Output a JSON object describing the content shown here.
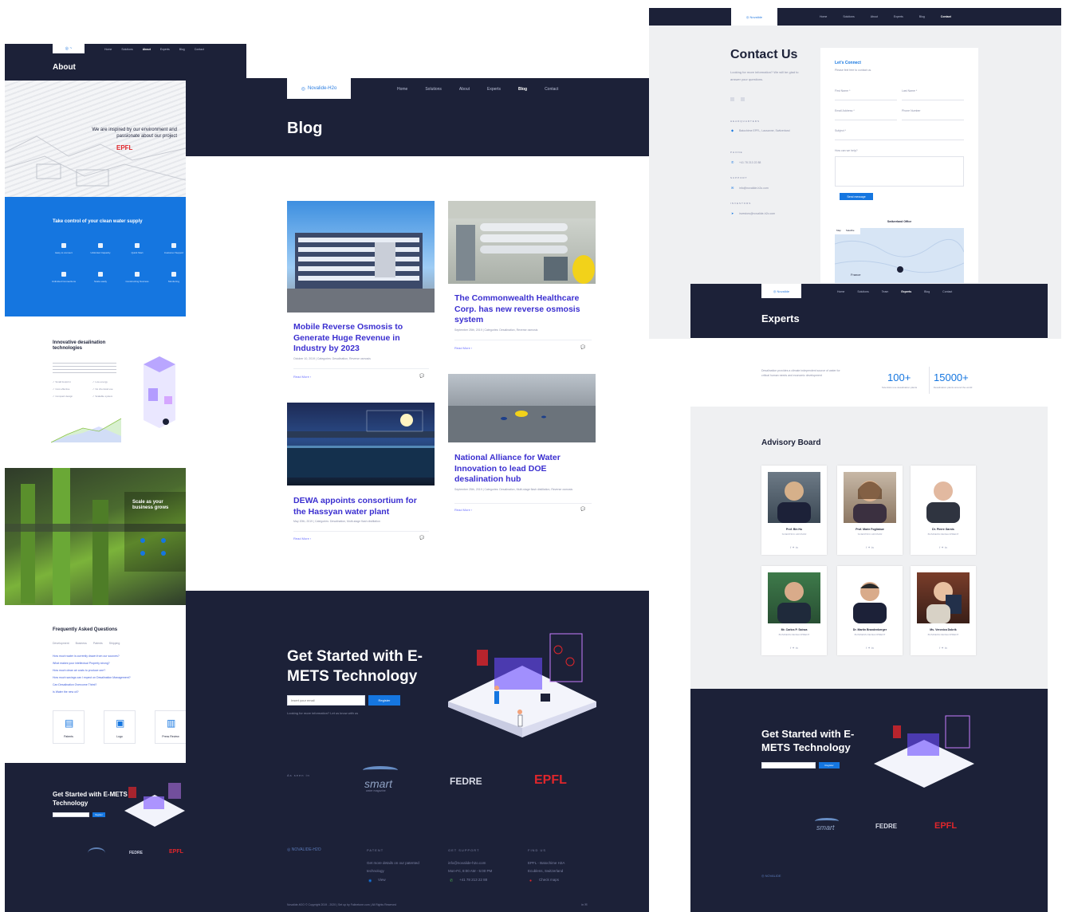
{
  "about_panel": {
    "nav_items": [
      "Home",
      "Solutions",
      "About",
      "Experts",
      "Blog",
      "Contact"
    ],
    "active_nav": "About",
    "title": "About",
    "hero_text": "We are inspired by our environment and passionate about our project",
    "hero_logo": "EPFL",
    "blue_title": "Take control of your clean water supply",
    "features": [
      "Easy to connect",
      "Unlimited Capacity",
      "Quick Start",
      "Customer Support",
      "Unlimited Connections",
      "Scale easily",
      "Constructing Success",
      "Monitoring"
    ],
    "innovative_title": "Innovative desalination technologies",
    "checks": [
      "Small footprint",
      "Low energy",
      "Cost effective",
      "No chemical use",
      "Compact design",
      "Scalable system"
    ],
    "scale_title": "Scale as your business grows",
    "faq_title": "Frequently Asked Questions",
    "faq_tabs": [
      "Development",
      "Business",
      "Patents",
      "Shipping"
    ],
    "faq_items": [
      "How much water is currently drawn from our sources?",
      "What makes your intellectual Property strong?",
      "How much clean air costs to produce one?",
      "How much savings can I expect on Desalination Management?",
      "Can Desalination Overcome Thirst?",
      "Is Water the new oil?"
    ],
    "docs": [
      "Patents",
      "Logo",
      "Press Review"
    ],
    "cta_title": "Get Started with E-METS Technology",
    "cta_button": "Register"
  },
  "blog_panel": {
    "nav_items": [
      "Home",
      "Solutions",
      "About",
      "Experts",
      "Blog",
      "Contact"
    ],
    "active_nav": "Blog",
    "logo_text": "Novalide-H2o",
    "title": "Blog",
    "posts": [
      {
        "title": "Mobile Reverse Osmosis to Generate Huge Revenue in Industry by 2023",
        "meta": "October 10, 2019 | Categories: Desalination, Reverse osmosis",
        "more": "Read More ›",
        "comments": "0"
      },
      {
        "title": "The Commonwealth Healthcare Corp. has new reverse osmosis system",
        "meta": "September 25th, 2019 | Categories: Desalination, Reverse osmosis",
        "more": "Read More ›",
        "comments": "0"
      },
      {
        "title": "DEWA appoints consortium for the Hassyan water plant",
        "meta": "May 20th, 2019 | Categories: Desalination, Multi-stage flash distillation",
        "more": "Read More ›",
        "comments": "0"
      },
      {
        "title": "National Alliance for Water Innovation to lead DOE desalination hub",
        "meta": "September 25th, 2019 | Categories: Desalination, Multi-stage flash distillation, Reverse osmosis",
        "more": "Read More ›",
        "comments": "0"
      }
    ],
    "cta_title": "Get Started with E-METS Technology",
    "cta_placeholder": "Insert your email",
    "cta_button": "Register",
    "cta_note": "Looking for more information? Let us know with us",
    "partners_label": "As seen in",
    "partners": [
      "smart",
      "FEDRE",
      "EPFL"
    ],
    "smart_sub": "water magazine",
    "footer": {
      "col1_head": "PATENT",
      "col1_text": "Get more details on our patented technology",
      "col1_link": "View",
      "col2_head": "GET SUPPORT",
      "col2_email": "info@novalide-h2o.com",
      "col2_hours": "Mon-Fri, 8:00 AM - 5:00 PM",
      "col2_phone": "+41 78 213 22 88",
      "col3_head": "FIND US",
      "col3_addr1": "EPFL - Batochime H2A",
      "col3_addr2": "Ecublens, Switzerland",
      "col3_link": "Check maps",
      "copyright": "Novalide-H2O © Copyright 2019 - 2020 | Set up by Falinetone.com | All Rights Reserved"
    }
  },
  "contact_panel": {
    "nav_items": [
      "Home",
      "Solutions",
      "About",
      "Experts",
      "Blog",
      "Contact"
    ],
    "active_nav": "Contact",
    "title": "Contact Us",
    "intro": "Looking for more information? We will be glad to answer your questions.",
    "headquarters_label": "HEADQUARTERS",
    "headquarters": "Batochime EPFL, Lausanne, Switzerland",
    "phone_label": "PHONE",
    "phone": "+41 78 213 22 88",
    "support_label": "SUPPORT",
    "support": "info@novalide-h2o.com",
    "investors_label": "INVESTORS",
    "investors": "investors@novalide-h2o.com",
    "form_title": "Let's Connect",
    "form_sub": "Please feel free to contact us.",
    "fields": [
      "First Name *",
      "Last Name *",
      "Email Address *",
      "Phone Number",
      "Subject *",
      "How can we help?"
    ],
    "send_button": "Send message",
    "map_title": "Switzerland Office",
    "map_tabs": [
      "Map",
      "Satellite"
    ],
    "map_label": "France"
  },
  "experts_panel": {
    "nav_items": [
      "Home",
      "Solutions",
      "Team",
      "Experts",
      "Blog",
      "Contact"
    ],
    "active_nav": "Experts",
    "title": "Experts",
    "intro": "Desalination provides a climate independent source of water for critical human needs and economic development",
    "stat1_value": "100+",
    "stat1_label": "Scientists use desalination plants",
    "stat2_value": "15000+",
    "stat2_label": "Desalination plants around the world",
    "board_title": "Advisory Board",
    "experts": [
      {
        "name": "Prof. Bin Hu",
        "role": "SCIENTIFIC ADVISOR"
      },
      {
        "name": "Prof. Marie Fogliabue",
        "role": "SCIENTIFIC ADVISOR"
      },
      {
        "name": "Dr. Pierre Garnis",
        "role": "BUSINESS DEVELOPMENT"
      },
      {
        "name": "Mr. Carlos P. Sainza",
        "role": "BUSINESS DEVELOPMENT"
      },
      {
        "name": "Dr. Martin Brandenberger",
        "role": "BUSINESS DEVELOPMENT"
      },
      {
        "name": "Ms. Veronica Dobrik",
        "role": "BUSINESS DEVELOPMENT"
      }
    ],
    "social": "f  ✦  in",
    "cta_title": "Get Started with E-METS Technology",
    "cta_button": "Register",
    "partners": [
      "smart",
      "FEDRE",
      "EPFL"
    ]
  },
  "colors": {
    "navy": "#1c2138",
    "blue": "#1576e0",
    "purple": "#3b2fd0",
    "epfl_red": "#e0262b"
  }
}
